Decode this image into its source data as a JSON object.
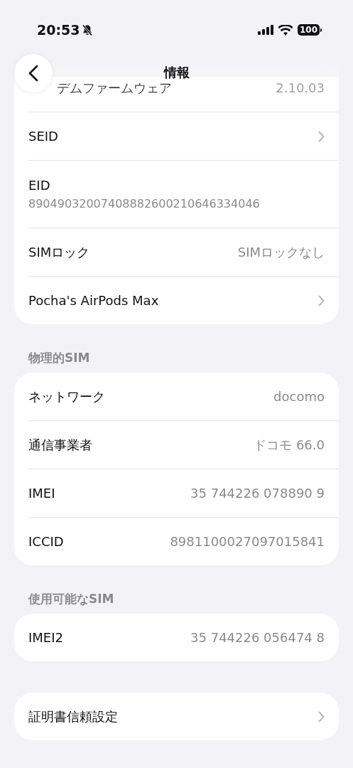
{
  "status_bar": {
    "time": "20:53",
    "silent": true,
    "battery": "100"
  },
  "nav": {
    "title": "情報"
  },
  "sections": [
    {
      "rows": [
        {
          "kind": "value",
          "label": "デムファームウェア",
          "value": "2.10.03",
          "faded": true
        },
        {
          "kind": "link",
          "label": "SEID"
        },
        {
          "kind": "stacked",
          "label": "EID",
          "value": "89049032007408882600210646334046"
        },
        {
          "kind": "value",
          "label": "SIMロック",
          "value": "SIMロックなし"
        },
        {
          "kind": "link",
          "label": "Pocha's AirPods Max"
        }
      ]
    },
    {
      "header": "物理的SIM",
      "rows": [
        {
          "kind": "value",
          "label": "ネットワーク",
          "value": "docomo"
        },
        {
          "kind": "value",
          "label": "通信事業者",
          "value": "ドコモ 66.0"
        },
        {
          "kind": "value",
          "label": "IMEI",
          "value": "35 744226 078890 9"
        },
        {
          "kind": "value",
          "label": "ICCID",
          "value": "8981100027097015841"
        }
      ]
    },
    {
      "header": "使用可能なSIM",
      "rows": [
        {
          "kind": "value",
          "label": "IMEI2",
          "value": "35 744226 056474 8"
        }
      ]
    },
    {
      "rows": [
        {
          "kind": "link",
          "label": "証明書信頼設定"
        }
      ]
    }
  ]
}
